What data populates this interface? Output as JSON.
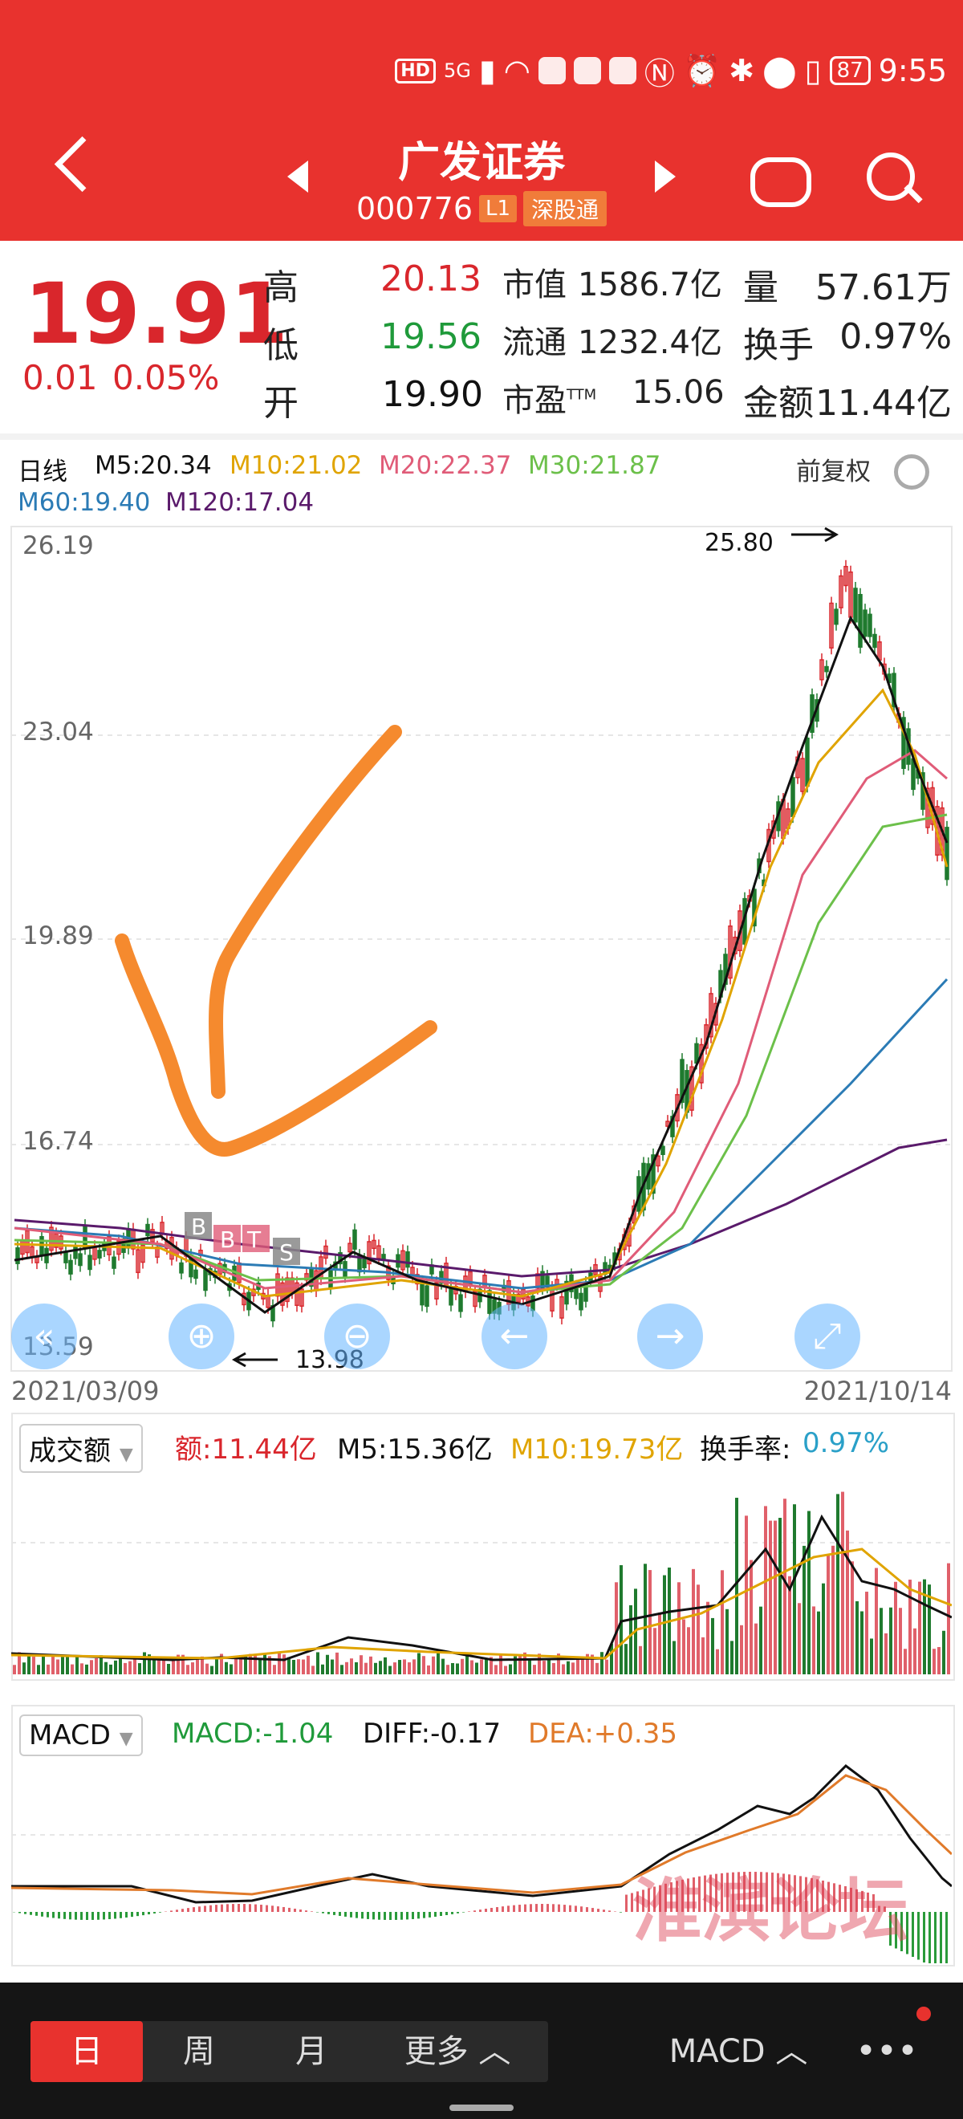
{
  "status_bar": {
    "time": "9:55",
    "battery": "87",
    "hd": "HD",
    "network": "5G"
  },
  "header": {
    "title": "广发证券",
    "code": "000776",
    "level_tag": "L1",
    "market_tag": "深股通"
  },
  "quote": {
    "price": "19.91",
    "change": "0.01",
    "change_pct": "0.05%",
    "high_label": "高",
    "high": "20.13",
    "low_label": "低",
    "low": "19.56",
    "open_label": "开",
    "open": "19.90",
    "mcap_label": "市值",
    "mcap": "1586.7亿",
    "float_label": "流通",
    "float": "1232.4亿",
    "pe_label": "市盈TTM",
    "pe": "15.06",
    "vol_label": "量",
    "vol": "57.61万",
    "turnover_label": "换手",
    "turnover": "0.97%",
    "amount_label": "金额",
    "amount": "11.44亿"
  },
  "kline": {
    "period": "日线",
    "adjust": "前复权",
    "m5": "M5:20.34",
    "m10": "M10:21.02",
    "m20": "M20:22.37",
    "m30": "M30:21.87",
    "m60": "M60:19.40",
    "m120": "M120:17.04",
    "y_ticks": [
      "26.19",
      "23.04",
      "19.89",
      "16.74",
      "13.59"
    ],
    "start_date": "2021/03/09",
    "end_date": "2021/10/14",
    "high_mark": "25.80",
    "low_mark": "13.98",
    "trade_marks": [
      "B",
      "B",
      "T",
      "S"
    ]
  },
  "volume_panel": {
    "selector": "成交额",
    "amount": "额:11.44亿",
    "m5": "M5:15.36亿",
    "m10": "M10:19.73亿",
    "turnover_label": "换手率:",
    "turnover": "0.97%"
  },
  "macd_panel": {
    "selector": "MACD",
    "macd": "MACD:-1.04",
    "diff": "DIFF:-0.17",
    "dea": "DEA:+0.35"
  },
  "watermark": "淮滨论坛",
  "bottom_tabs": {
    "day": "日",
    "week": "周",
    "month": "月",
    "more": "更多",
    "indicator": "MACD"
  },
  "colors": {
    "header": "#e8322e",
    "up": "#d9262c",
    "down": "#1f9a3a",
    "m5": "#111111",
    "m10": "#e0a400",
    "m20": "#e05c78",
    "m30": "#6cc04a",
    "m60": "#2b7bb5",
    "m120": "#5a1a6b"
  }
}
